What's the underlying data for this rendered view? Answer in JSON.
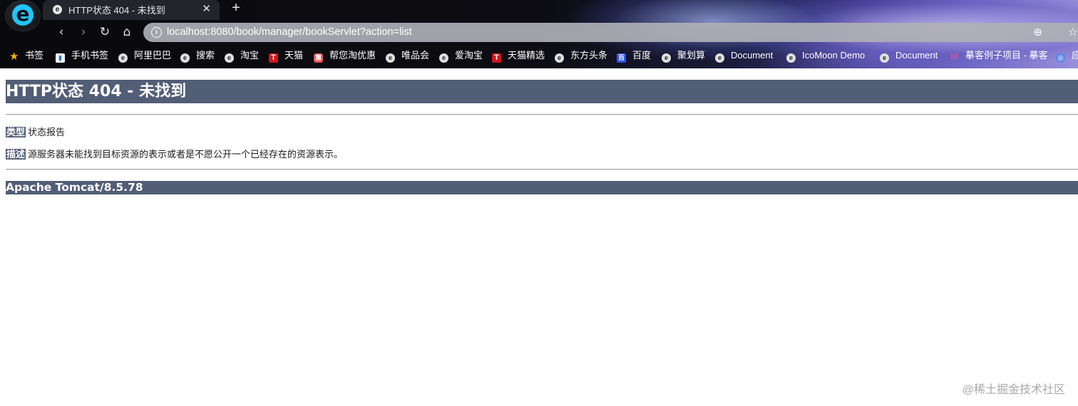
{
  "browser": {
    "tab": {
      "favicon": "e",
      "title": "HTTP状态 404 - 未找到",
      "close": "✕"
    },
    "new_tab": "+",
    "logo": "e",
    "nav": {
      "back": "‹",
      "forward": "›",
      "reload": "↻",
      "home": "⌂"
    },
    "address": {
      "info": "i",
      "url": "localhost:8080/book/manager/bookServlet?action=list",
      "zoom": "⊕",
      "star": "☆"
    },
    "bookmarks": [
      {
        "icon": "★",
        "label": "书签"
      },
      {
        "icon": "▮",
        "label": "手机书签"
      },
      {
        "icon": "e",
        "label": "阿里巴巴"
      },
      {
        "icon": "e",
        "label": "搜索"
      },
      {
        "icon": "e",
        "label": "淘宝"
      },
      {
        "icon": "T",
        "label": "天猫"
      },
      {
        "icon": "惠",
        "label": "帮您淘优惠"
      },
      {
        "icon": "e",
        "label": "唯品会"
      },
      {
        "icon": "e",
        "label": "爱淘宝"
      },
      {
        "icon": "T",
        "label": "天猫精选"
      },
      {
        "icon": "e",
        "label": "东方头条"
      },
      {
        "icon": "百",
        "label": "百度"
      },
      {
        "icon": "e",
        "label": "聚划算"
      },
      {
        "icon": "e",
        "label": "Document"
      },
      {
        "icon": "e",
        "label": "IcoMoon Demo"
      },
      {
        "icon": "e",
        "label": "Document"
      },
      {
        "icon": "✉",
        "label": "摹客例子项目 - 摹客"
      },
      {
        "icon": "◎",
        "label": "应"
      }
    ]
  },
  "page": {
    "title": "HTTP状态 404 - 未找到",
    "type_label": "类型",
    "type_value": "状态报告",
    "desc_label": "描述",
    "desc_value": "源服务器未能找到目标资源的表示或者是不愿公开一个已经存在的资源表示。",
    "server": "Apache Tomcat/8.5.78"
  },
  "watermark": "@稀土掘金技术社区",
  "colors": {
    "tomcat_header": "#525d76",
    "accent": "#1ec7ff"
  }
}
